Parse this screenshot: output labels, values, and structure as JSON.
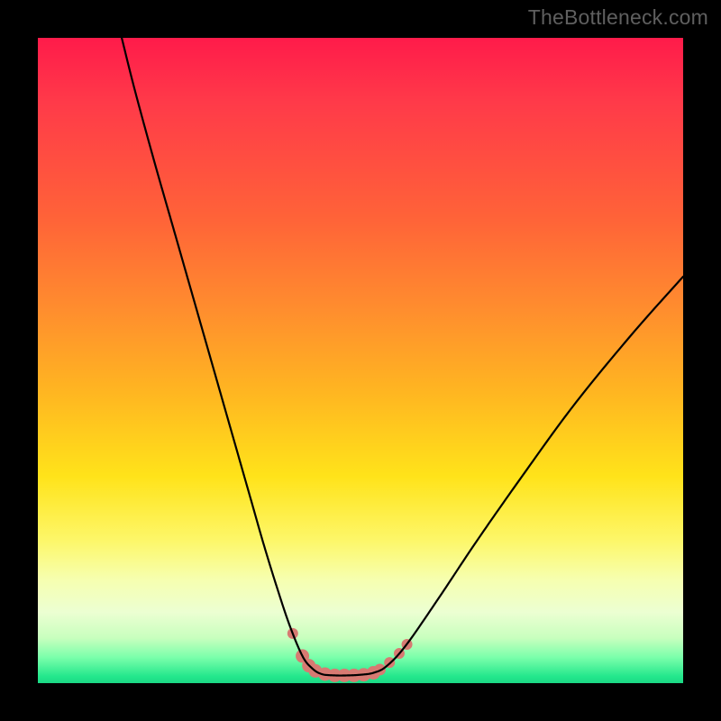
{
  "watermark": "TheBottleneck.com",
  "chart_data": {
    "type": "line",
    "title": "",
    "xlabel": "",
    "ylabel": "",
    "xlim": [
      0,
      100
    ],
    "ylim": [
      0,
      100
    ],
    "series": [
      {
        "name": "bottleneck-curve",
        "x": [
          13,
          15,
          18,
          21,
          24,
          27,
          30,
          33,
          35,
          37,
          39,
          41,
          42.5,
          44,
          46,
          48,
          50,
          52,
          54,
          57,
          62,
          68,
          75,
          83,
          92,
          100
        ],
        "values": [
          100,
          92,
          81,
          70.5,
          60,
          49.5,
          39,
          28.5,
          21.5,
          15,
          9,
          4.2,
          2.3,
          1.4,
          1.2,
          1.2,
          1.3,
          1.6,
          2.6,
          5.8,
          13,
          22,
          32,
          43,
          54,
          63
        ]
      }
    ],
    "markers": {
      "name": "highlight-dots",
      "x": [
        39.5,
        41,
        42,
        43,
        44.5,
        46,
        47.5,
        49,
        50.5,
        52,
        53,
        54.5,
        56,
        57.2
      ],
      "values": [
        7.7,
        4.2,
        2.7,
        1.9,
        1.4,
        1.2,
        1.2,
        1.2,
        1.3,
        1.6,
        2.1,
        3.2,
        4.6,
        6.0
      ],
      "r": [
        6,
        7.5,
        7.5,
        7.5,
        7.5,
        7.5,
        7.5,
        7.5,
        7.5,
        7.5,
        6.5,
        6,
        6,
        6
      ]
    }
  }
}
